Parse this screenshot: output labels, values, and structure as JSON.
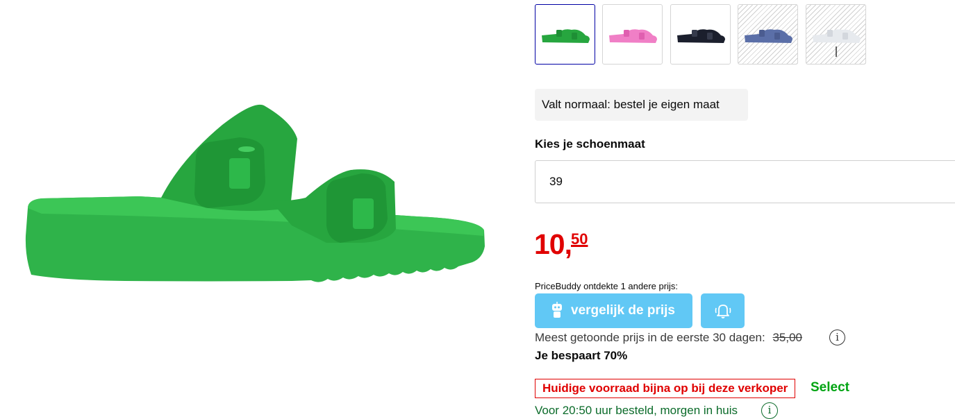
{
  "product": {
    "image": {
      "subject": "sandal-photo",
      "color": "#2fb34a"
    }
  },
  "variants": [
    {
      "color": "#27a63f",
      "available": true,
      "selected": true
    },
    {
      "color": "#f07fc6",
      "available": true,
      "selected": false
    },
    {
      "color": "#1b1f2d",
      "available": true,
      "selected": false
    },
    {
      "color": "#5b6fa8",
      "available": false,
      "selected": false
    },
    {
      "color": "#e7eaee",
      "available": false,
      "selected": false
    }
  ],
  "fit_hint": "Valt normaal: bestel je eigen maat",
  "size": {
    "label": "Kies je schoenmaat",
    "value": "39"
  },
  "price": {
    "integer": "10,",
    "fraction": "50",
    "color": "#e00000"
  },
  "pricebuddy": {
    "intro": "PriceBuddy ontdekte 1 andere prijs:",
    "compare_label": "vergelijk de prijs",
    "color": "#61c8f5"
  },
  "reference_price": {
    "text": "Meest getoonde prijs in de eerste 30 dagen:",
    "old_price": "35,00",
    "info": "i"
  },
  "savings": "Je bespaart 70%",
  "stock_warning": "Huidige voorraad bijna op bij deze verkoper",
  "seller": "Select",
  "delivery": {
    "text": "Voor 20:50 uur besteld, morgen in huis",
    "info": "i"
  }
}
